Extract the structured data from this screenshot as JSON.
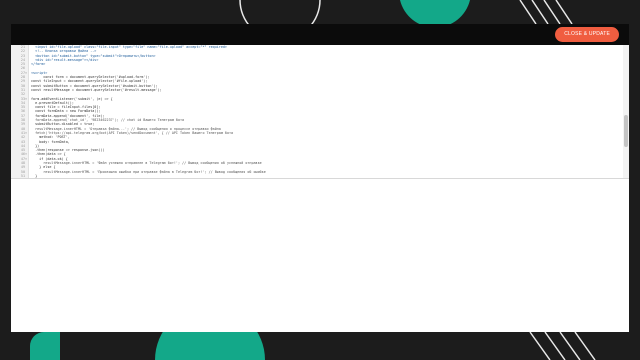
{
  "toolbar": {
    "save_label": "CLOSE & UPDATE"
  },
  "colors": {
    "accent": "#f05d40",
    "teal": "#13a889",
    "dark": "#1c1c1c"
  },
  "editor": {
    "lines": [
      {
        "n": "21",
        "fold": "",
        "code": "  <input id=\"file-upload\" class=\"file-input\" type=\"file\" name=\"file-upload\" accept=\"*\" required>"
      },
      {
        "n": "22",
        "fold": "",
        "code": "  <!-- Кнопка отправки файла -->"
      },
      {
        "n": "23",
        "fold": "",
        "code": "  <button id=\"submit-button\" type=\"submit\">Отправить</button>"
      },
      {
        "n": "24",
        "fold": "",
        "code": "  <div id=\"result-message\"></div>"
      },
      {
        "n": "25",
        "fold": "",
        "code": "</form>"
      },
      {
        "n": "26",
        "fold": "",
        "code": ""
      },
      {
        "n": "27",
        "fold": "▾",
        "code": "<script>"
      },
      {
        "n": "28",
        "fold": "",
        "code": "      const form = document.querySelector('#upload-form');"
      },
      {
        "n": "29",
        "fold": "",
        "code": "const fileInput = document.querySelector('#file-upload');"
      },
      {
        "n": "30",
        "fold": "",
        "code": "const submitButton = document.querySelector('#submit-button');"
      },
      {
        "n": "31",
        "fold": "",
        "code": "const resultMessage = document.querySelector('#result-message');"
      },
      {
        "n": "32",
        "fold": "",
        "code": ""
      },
      {
        "n": "33",
        "fold": "▾",
        "code": "form.addEventListener('submit', (e) => {"
      },
      {
        "n": "34",
        "fold": "",
        "code": "  e.preventDefault();"
      },
      {
        "n": "35",
        "fold": "",
        "code": "  const file = fileInput.files[0];"
      },
      {
        "n": "36",
        "fold": "",
        "code": "  const formData = new FormData();"
      },
      {
        "n": "37",
        "fold": "",
        "code": "  formData.append('document', file);"
      },
      {
        "n": "38",
        "fold": "",
        "code": "  formData.append('chat_id', '9823462237'); // chat id Вашего Телеграм бота"
      },
      {
        "n": "39",
        "fold": "",
        "code": "  submitButton.disabled = true;"
      },
      {
        "n": "40",
        "fold": "",
        "code": "  resultMessage.innerHTML = 'Отправка файла...'; // Вывод сообщения о процессе отправки файла"
      },
      {
        "n": "41",
        "fold": "▾",
        "code": "  fetch('https://api.telegram.org/bot(API Token)/sendDocument', { // API Token Вашего Телеграм бота"
      },
      {
        "n": "42",
        "fold": "",
        "code": "    method: 'POST',"
      },
      {
        "n": "43",
        "fold": "",
        "code": "    body: formData,"
      },
      {
        "n": "44",
        "fold": "",
        "code": "  })"
      },
      {
        "n": "45",
        "fold": "",
        "code": "  .then(response => response.json())"
      },
      {
        "n": "46",
        "fold": "▾",
        "code": "  .then(data => {"
      },
      {
        "n": "47",
        "fold": "▾",
        "code": "    if (data.ok) {"
      },
      {
        "n": "48",
        "fold": "",
        "code": "      resultMessage.innerHTML = 'Файл успешно отправлен в Telegram бот!'; // Вывод сообщения об успешной отправке"
      },
      {
        "n": "49",
        "fold": "",
        "code": "    } else {"
      },
      {
        "n": "50",
        "fold": "",
        "code": "      resultMessage.innerHTML = 'Произошла ошибка при отправке файла в Telegram бот!'; // Вывод сообщения об ошибке"
      },
      {
        "n": "51",
        "fold": "",
        "code": "  }"
      }
    ]
  }
}
